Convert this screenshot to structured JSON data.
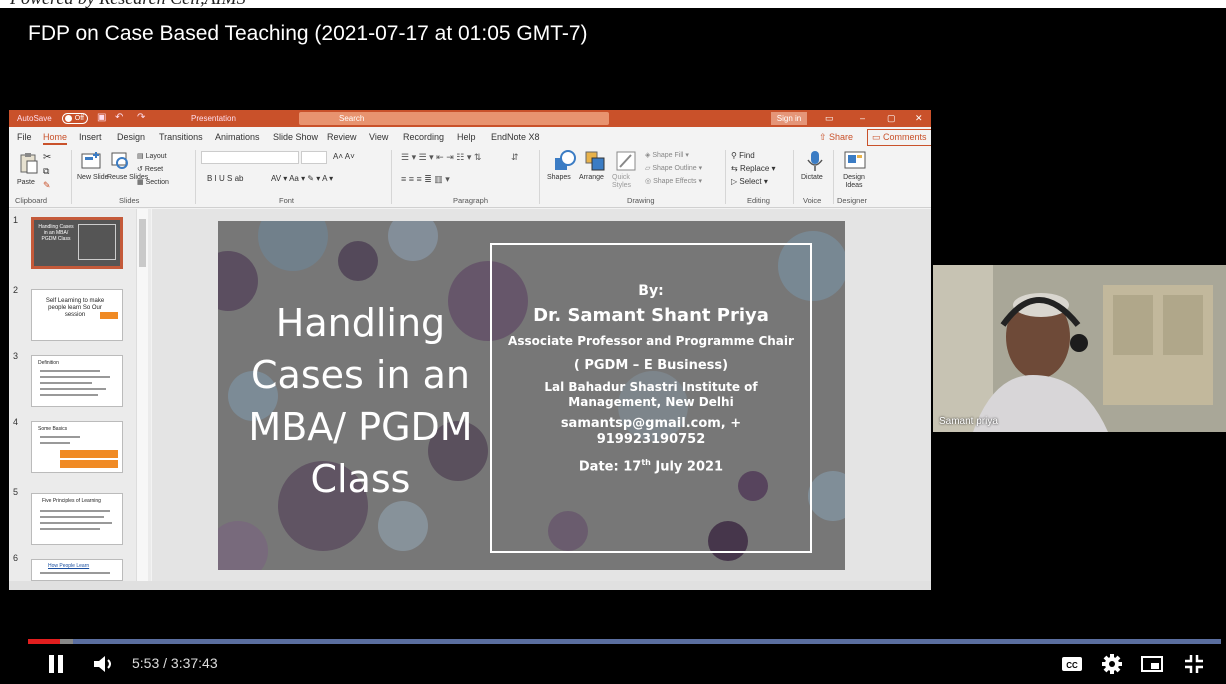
{
  "header_caption": "Powered by Research Cell,AIMS",
  "video_title": "FDP on Case Based Teaching (2021-07-17 at 01:05 GMT-7)",
  "ppt": {
    "titlebar": {
      "autosave": "AutoSave",
      "autosave_state": "Off",
      "doc_name": "Presentation",
      "search": "Search",
      "sign_in": "Sign in"
    },
    "menu": [
      "File",
      "Home",
      "Insert",
      "Design",
      "Transitions",
      "Animations",
      "Slide Show",
      "Review",
      "View",
      "Recording",
      "Help",
      "EndNote X8"
    ],
    "share": "Share",
    "comments": "Comments",
    "ribbon": {
      "paste": "Paste",
      "new_slide": "New Slide",
      "reuse_slides": "Reuse Slides",
      "layout": "Layout",
      "reset": "Reset",
      "section": "Section",
      "font_buttons": "B  I  U  S  ab",
      "shapes": "Shapes",
      "arrange": "Arrange",
      "quick_styles": "Quick Styles",
      "shape_fill": "Shape Fill",
      "shape_outline": "Shape Outline",
      "shape_effects": "Shape Effects",
      "find": "Find",
      "replace": "Replace",
      "select": "Select",
      "dictate": "Dictate",
      "design_ideas": "Design Ideas",
      "groups": [
        "Clipboard",
        "Slides",
        "Font",
        "Paragraph",
        "Drawing",
        "Editing",
        "Voice",
        "Designer"
      ]
    },
    "thumbnails": [
      {
        "num": "1",
        "text": "Handling Cases in an MBA/ PGDM Class"
      },
      {
        "num": "2",
        "text": "Self Learning to make people learn So Our session"
      },
      {
        "num": "3",
        "text": "Definition"
      },
      {
        "num": "4",
        "text": "Some Basics"
      },
      {
        "num": "5",
        "text": "Five Principles of Learning"
      },
      {
        "num": "6",
        "text": "How People Learn"
      }
    ],
    "slide": {
      "title": "Handling Cases in an MBA/ PGDM Class",
      "by": "By:",
      "author": "Dr. Samant Shant Priya",
      "role": "Associate Professor and Programme Chair",
      "program": "( PGDM – E Business)",
      "institute": "Lal Bahadur Shastri Institute of Management, New Delhi",
      "contact": "samantsp@gmail.com, + 919923190752",
      "date_prefix": "Date: 17",
      "date_sup": "th",
      "date_suffix": " July 2021"
    }
  },
  "participant": {
    "name": "Samant priya"
  },
  "player": {
    "current_time": "5:53",
    "duration": "3:37:43",
    "progress_fraction": 0.027
  }
}
